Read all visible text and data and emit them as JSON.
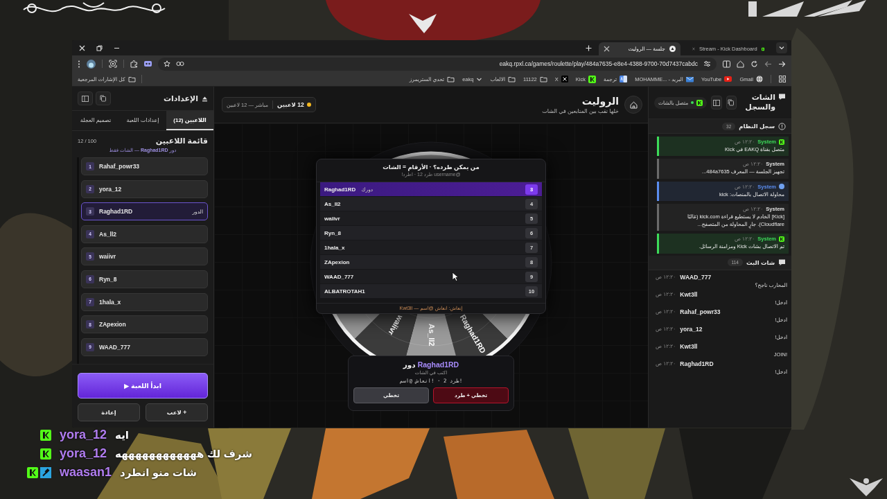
{
  "browser": {
    "tabs": [
      {
        "label": "Stream - Kick Dashboard",
        "selected": false,
        "kind": "kick"
      },
      {
        "label": "جلسة — الروليت",
        "selected": true,
        "kind": "app"
      }
    ],
    "url": "eakq.rpxl.ca/games/roulette/play/484a7635-e8e4-4388-9700-70d7437cabdc",
    "bookmarks": [
      {
        "label": "Gmail",
        "kind": "globe"
      },
      {
        "label": "YouTube",
        "kind": "youtube"
      },
      {
        "label": "MOHAMME... - البريد",
        "kind": "mail"
      },
      {
        "label": "ترجمة",
        "kind": "translate"
      },
      {
        "label": "Kick",
        "kind": "kick"
      },
      {
        "label": "X",
        "kind": "x"
      },
      {
        "label": "11122",
        "kind": "folder"
      },
      {
        "label": "الالعاب",
        "kind": "folder"
      },
      {
        "label": "eakq",
        "kind": "dropdown"
      },
      {
        "label": "تحدي الستريمرز",
        "kind": "folder"
      }
    ],
    "all_bookmarks": "كل الإشارات المرجعية"
  },
  "settings": {
    "title": "الإعدادات",
    "tabs": [
      {
        "label": "اللاعبين (12)",
        "selected": true
      },
      {
        "label": "إعدادات اللعبة",
        "selected": false
      },
      {
        "label": "تصميم العجلة",
        "selected": false
      }
    ],
    "list_title": "قائمة اللاعبين",
    "count": "12 / 100",
    "turn_note": "دور **Raghad1RD** — الشات فقط",
    "players": [
      {
        "number": "1",
        "name": "Rahaf_powr33",
        "selected": false
      },
      {
        "number": "2",
        "name": "yora_12",
        "selected": false
      },
      {
        "number": "3",
        "name": "Raghad1RD",
        "selected": true,
        "tag": "الدور"
      },
      {
        "number": "4",
        "name": "As_ll2",
        "selected": false
      },
      {
        "number": "5",
        "name": "waiivr",
        "selected": false
      },
      {
        "number": "6",
        "name": "Ryn_8",
        "selected": false
      },
      {
        "number": "7",
        "name": "1hala_x",
        "selected": false
      },
      {
        "number": "8",
        "name": "ZApexion",
        "selected": false
      },
      {
        "number": "9",
        "name": "WAAD_777",
        "selected": false
      }
    ],
    "start_button": "ابدأ اللعبة ▶",
    "reset_button": "إعادة",
    "add_button": "+ لاعب"
  },
  "stage": {
    "title": "الروليت",
    "subtitle": "خلها تقب بين المتابعين في الشات",
    "player_count": "12 لاعبين",
    "live_status": "مباشر — 12 لاعبين",
    "kick_dialog": {
      "title": "من يمكن طرده؟ · الأرقام = الشات",
      "hint": "@username طرد 12 · اطرد!",
      "rows": [
        {
          "name": "Raghad1RD",
          "number": "3",
          "selected": true,
          "tag": "دورك"
        },
        {
          "name": "As_ll2",
          "number": "4",
          "selected": false
        },
        {
          "name": "waiivr",
          "number": "5",
          "selected": false
        },
        {
          "name": "Ryn_8",
          "number": "6",
          "selected": false
        },
        {
          "name": "1hala_x",
          "number": "7",
          "selected": false
        },
        {
          "name": "ZApexion",
          "number": "8",
          "selected": false
        },
        {
          "name": "WAAD_777",
          "number": "9",
          "selected": false
        },
        {
          "name": "ALBATROTAH1",
          "number": "10",
          "selected": false
        }
      ],
      "footer": "إنعاش: انعاش @اسم — Kwt3ll"
    },
    "wheel": {
      "labels": [
        "Raghad1RD",
        "As_ll2",
        "waiivr"
      ]
    },
    "turn_card": {
      "player": "Raghad1RD",
      "label": "دور",
      "instruction": "اكتب في الشات",
      "commands": "!طرد 2 · !انعاش @اسم",
      "buttons": [
        {
          "label": "تخطي + طرد",
          "kind": "danger"
        },
        {
          "label": "تخطي",
          "kind": "secondary"
        }
      ]
    }
  },
  "chat": {
    "title": "الشات والسجل",
    "connection": "متصل بالشات",
    "connected": true,
    "log_title": "سجل النظام",
    "log_count": "32",
    "log": [
      {
        "author": "System",
        "time": "١٢:٢٠ ص",
        "text": "متصل بقناة EAKQ في Kick",
        "color": "#3ddc5a",
        "kind": "kick"
      },
      {
        "author": "System",
        "time": "١٢:٢٠ ص",
        "text": "تجهيز الجلسة — المعرف 484a7635...",
        "color": "#6b6b6b",
        "kind": "none"
      },
      {
        "author": "System",
        "time": "١٢:٢٠ ص",
        "text": "محاولة الاتصال بالمنصات: kick",
        "color": "#5b8def",
        "kind": "web"
      },
      {
        "author": "System",
        "time": "١٢:٢٠ ص",
        "text": "[Kick] الخادم لا يستطيع قراءة kick.com (غالبًا Cloudflare). جارٍ المحاولة من المتصفح...",
        "color": "#6b6b6b",
        "kind": "none"
      },
      {
        "author": "System",
        "time": "١٢:٢٠ ص",
        "text": "تم الاتصال بشات Kick ومزامنة الرسائل.",
        "color": "#3ddc5a",
        "kind": "kick"
      }
    ],
    "chat_title": "شات البث",
    "chat_count": "114",
    "messages": [
      {
        "user": "WAAD_777",
        "time": "١٢:٢٠ ص",
        "text": "المحارب ناجح؟"
      },
      {
        "user": "Kwt3ll",
        "time": "١٢:٢٠ ص",
        "text": "ادخل!"
      },
      {
        "user": "Rahaf_powr33",
        "time": "١٢:٢٠ ص",
        "text": "ادخل!"
      },
      {
        "user": "yora_12",
        "time": "١٢:٢٠ ص",
        "text": "ادخل!"
      },
      {
        "user": "Kwt3ll",
        "time": "١٢:٢٠ ص",
        "text": "JOIN!"
      },
      {
        "user": "Raghad1RD",
        "time": "١٢:٢٠ ص",
        "text": "ادخل!"
      }
    ]
  },
  "overlay_chat": [
    {
      "kick_badge": true,
      "moderator_badge": false,
      "user": "yora_12",
      "text": "ايه"
    },
    {
      "kick_badge": true,
      "moderator_badge": false,
      "user": "yora_12",
      "text": "شرف لك ههههههههههههه"
    },
    {
      "kick_badge": true,
      "moderator_badge": true,
      "user": "waasan1",
      "text": "شات منو انطرد"
    }
  ]
}
